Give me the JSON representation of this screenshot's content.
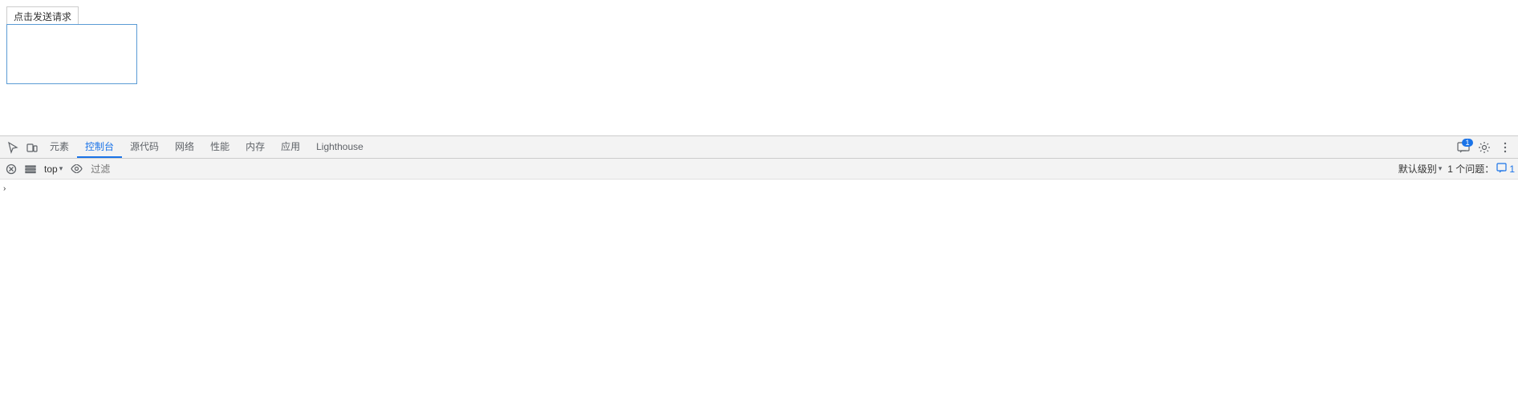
{
  "page": {
    "send_btn_label": "点击发送请求"
  },
  "devtools": {
    "tabs": [
      {
        "id": "elements",
        "label": "元素",
        "active": false
      },
      {
        "id": "console",
        "label": "控制台",
        "active": true
      },
      {
        "id": "source",
        "label": "源代码",
        "active": false
      },
      {
        "id": "network",
        "label": "网络",
        "active": false
      },
      {
        "id": "performance",
        "label": "性能",
        "active": false
      },
      {
        "id": "memory",
        "label": "内存",
        "active": false
      },
      {
        "id": "application",
        "label": "应用",
        "active": false
      },
      {
        "id": "lighthouse",
        "label": "Lighthouse",
        "active": false
      }
    ],
    "message_badge": "1",
    "console_toolbar": {
      "top_label": "top",
      "filter_placeholder": "过滤",
      "default_levels_label": "默认级别",
      "issues_label": "1 个问题：",
      "issues_count": "1"
    }
  }
}
